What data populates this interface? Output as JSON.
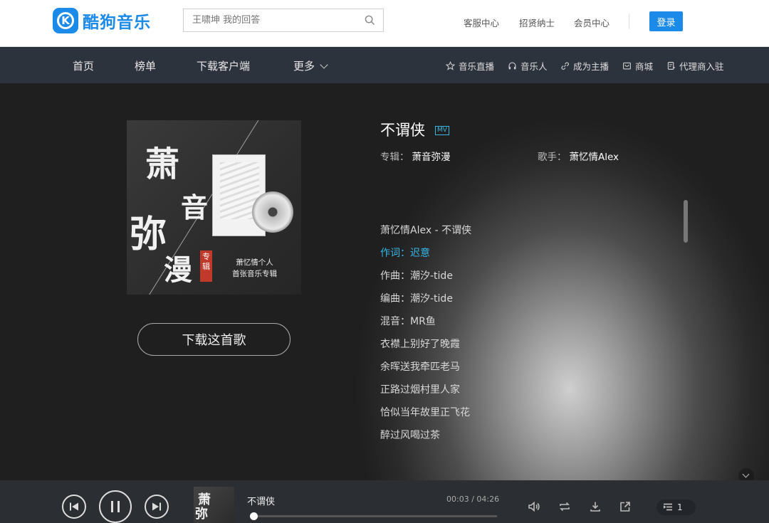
{
  "header": {
    "logo_text": "酷狗音乐",
    "logo_letter": "K",
    "search": {
      "placeholder": "王啸坤 我的回答",
      "value": ""
    },
    "links": [
      "客服中心",
      "招贤纳士",
      "会员中心"
    ],
    "login_label": "登录"
  },
  "nav": {
    "items": [
      "首页",
      "榜单",
      "下载客户端",
      "更多"
    ],
    "links": [
      "音乐直播",
      "音乐人",
      "成为主播",
      "商城",
      "代理商入驻"
    ]
  },
  "song": {
    "title": "不谓侠",
    "mv_badge": "MV",
    "album_label": "专辑：",
    "album": "萧音弥漫",
    "artist_label": "歌手：",
    "artist": "萧忆情Alex",
    "download_label": "下载这首歌"
  },
  "cover": {
    "chars": [
      "萧",
      "音",
      "弥",
      "漫"
    ],
    "tag": "专辑",
    "sub_line1": "萧忆情个人",
    "sub_line2": "首张音乐专辑"
  },
  "lyrics": [
    "萧忆情Alex - 不谓侠",
    "作词：迟意",
    "作曲：潮汐-tide",
    "编曲：潮汐-tide",
    "混音：MR鱼",
    "衣襟上别好了晚霞",
    "余晖送我牵匹老马",
    "正路过烟村里人家",
    "恰似当年故里正飞花",
    "醉过风喝过茶"
  ],
  "lyrics_active_index": 1,
  "player": {
    "title": "不谓侠",
    "time": "00:03 / 04:26",
    "progress_fraction": 0.012,
    "queue_count": "1"
  },
  "colors": {
    "brand": "#1c8ae8",
    "lyric_active": "#35b7e6",
    "nav_bg": "#2d333c",
    "player_bg": "#2b2e33"
  },
  "icons": [
    "search-icon",
    "star-icon",
    "headphones-icon",
    "link-icon",
    "shop-icon",
    "agent-icon",
    "prev-icon",
    "pause-icon",
    "next-icon",
    "volume-icon",
    "repeat-icon",
    "download-icon",
    "share-icon",
    "playlist-icon"
  ]
}
